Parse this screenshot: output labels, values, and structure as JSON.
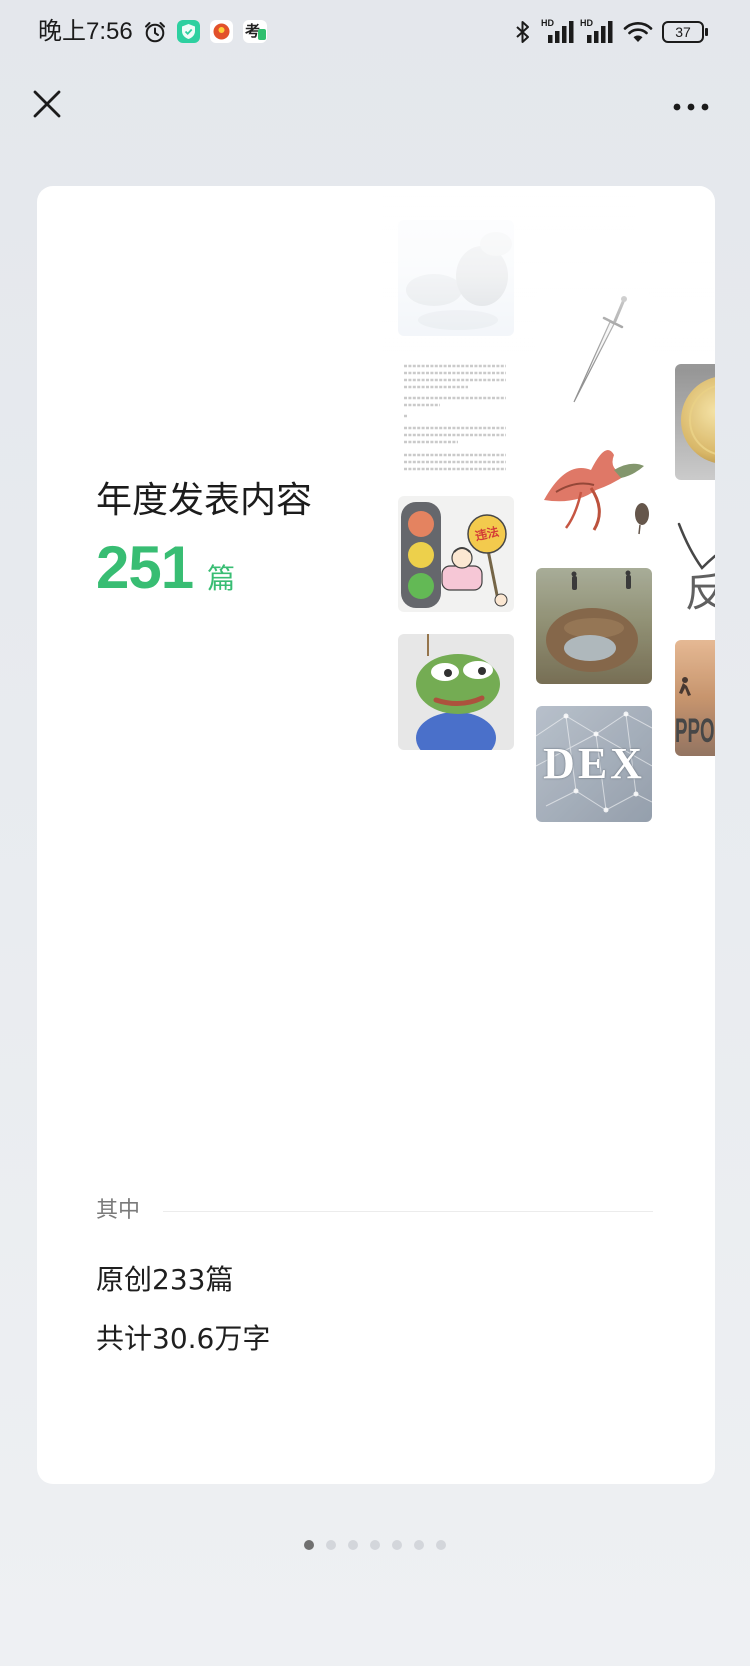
{
  "status_bar": {
    "time": "晚上7:56",
    "left_icons": [
      "alarm-icon",
      "green-shield-app-icon",
      "orange-circle-app-icon",
      "kao-app-icon"
    ],
    "kao_app_glyph": "考",
    "right_icons": [
      "bluetooth-icon",
      "signal-hd-icon",
      "signal-hd-icon",
      "wifi-icon",
      "battery-icon"
    ],
    "signal_1_label": "HD",
    "signal_2_label": "HD",
    "battery_level": "37"
  },
  "nav": {
    "close_icon": "close-icon",
    "more_icon": "more-icon"
  },
  "card": {
    "title": "年度发表内容",
    "count": "251",
    "count_unit": "篇",
    "breakdown_label": "其中",
    "original_posts": "原创233篇",
    "total_words": "共计30.6万字"
  },
  "collage": {
    "traffic_sign_text": "违法",
    "dex_text": "DEX",
    "partial_char": "反",
    "ppo_text": "PPO"
  },
  "pagination": {
    "pages": 7,
    "current": 1
  },
  "colors": {
    "accent": "#38bd73",
    "page_bg": "#e8ebef",
    "card_bg": "#ffffff",
    "text_primary": "#1c1c1c",
    "text_secondary": "#7a7a7a",
    "dot_active": "#707070",
    "dot_inactive": "#d3d6db"
  }
}
